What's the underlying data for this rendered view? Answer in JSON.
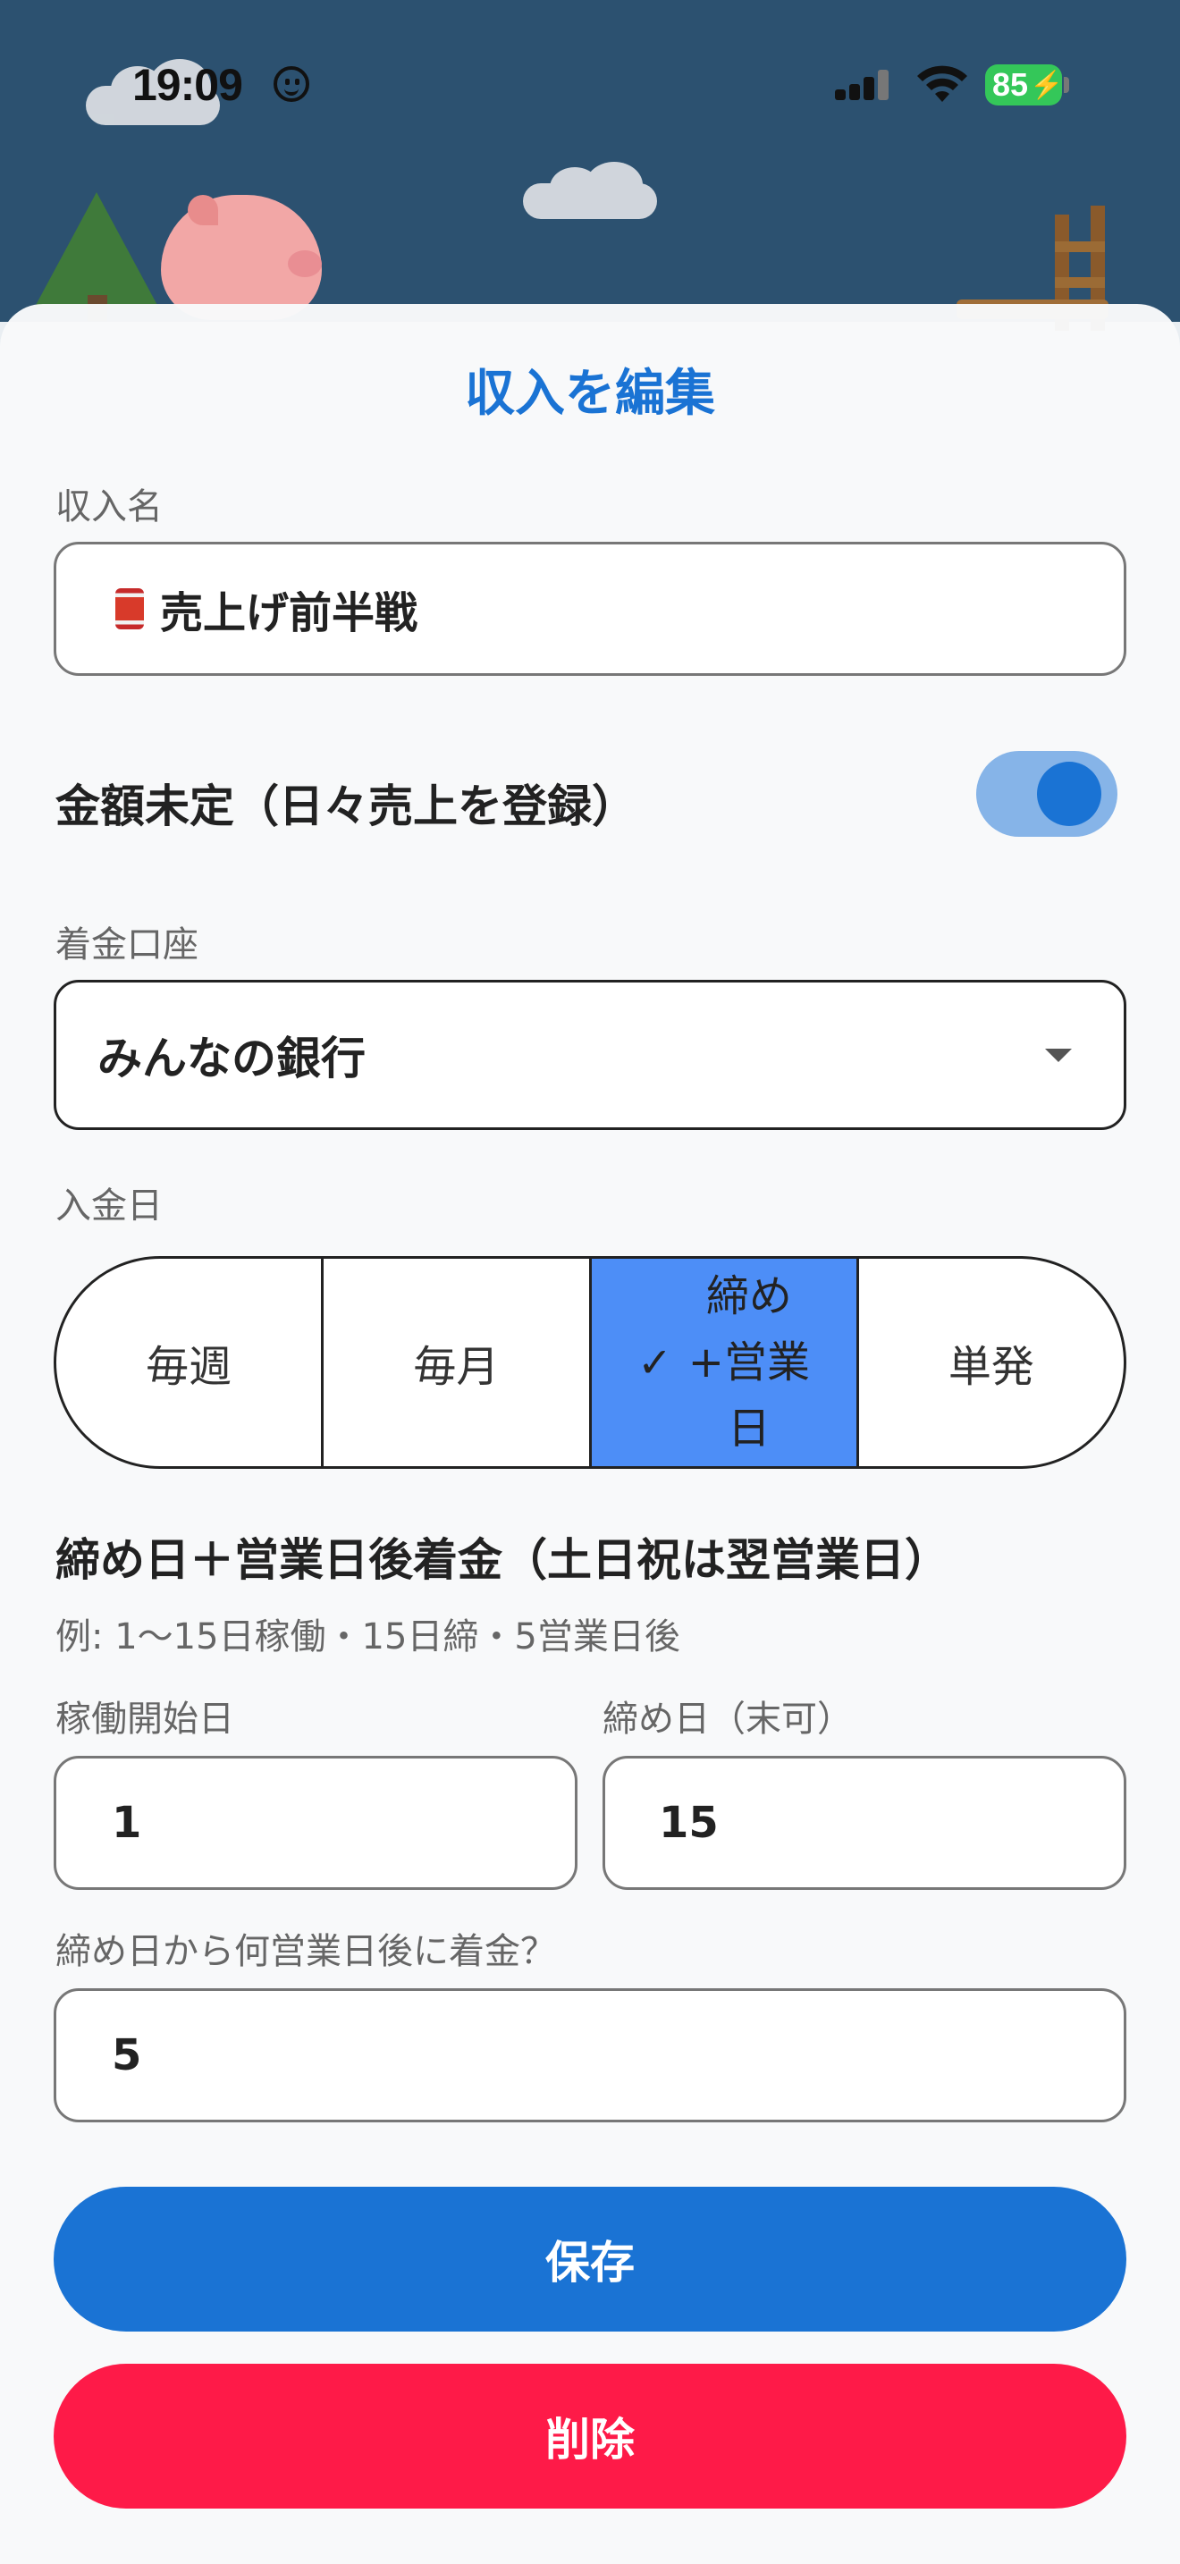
{
  "status_bar": {
    "time": "19:09",
    "battery": "85"
  },
  "sheet": {
    "title": "収入を編集",
    "name_label": "収入名",
    "name_value": "売上げ前半戦",
    "amount_toggle_label": "金額未定（日々売上を登録）",
    "amount_toggle_on": true,
    "account_label": "着金口座",
    "account_value": "みんなの銀行",
    "pay_day_label": "入金日",
    "pay_day_options": [
      "毎週",
      "毎月",
      "締め+営業日",
      "単発"
    ],
    "pay_day_selected": "締め+営業日",
    "pay_day_selected_lines": [
      "締め",
      "+営業",
      "日"
    ],
    "section_title": "締め日＋営業日後着金（土日祝は翌営業日）",
    "example_hint": "例: 1〜15日稼働・15日締・5営業日後",
    "start_day_label": "稼働開始日",
    "start_day_value": "1",
    "closing_day_label": "締め日（末可）",
    "closing_day_value": "15",
    "business_days_label": "締め日から何営業日後に着金？",
    "business_days_value": "5",
    "save_label": "保存",
    "delete_label": "削除"
  },
  "colors": {
    "accent": "#1a73d4",
    "segment_active": "#4d8ef7",
    "delete": "#fe1a48",
    "toggle_track": "#86b4e8"
  },
  "icons": {
    "name_field_icon": "canned-food-icon",
    "select_arrow": "chevron-down-icon",
    "segment_check": "checkmark-icon"
  }
}
